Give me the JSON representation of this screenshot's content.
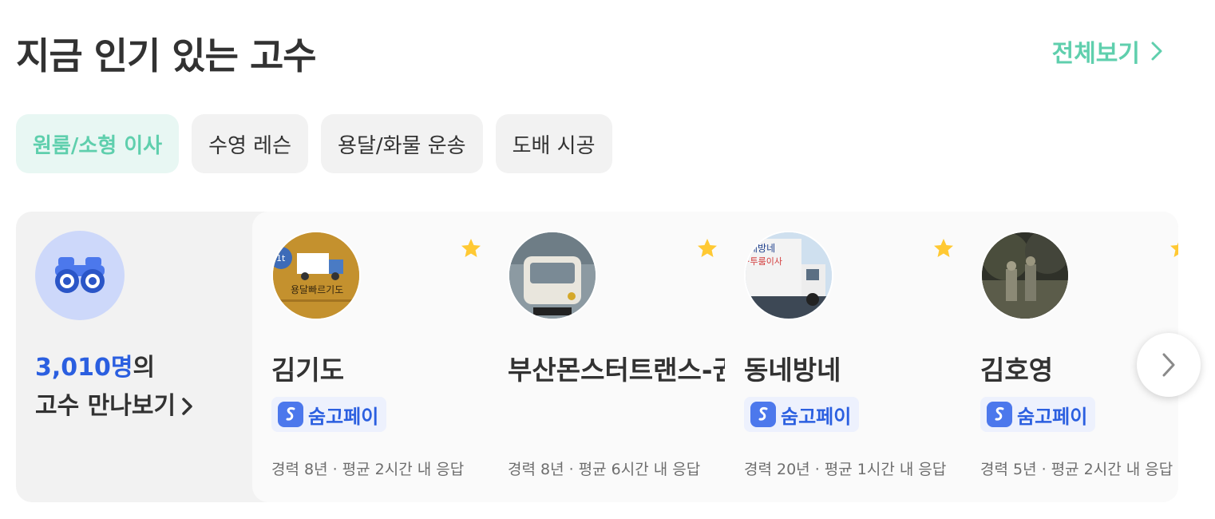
{
  "header": {
    "title": "지금 인기 있는 고수",
    "view_all": "전체보기"
  },
  "chips": [
    {
      "label": "원룸/소형 이사",
      "active": true
    },
    {
      "label": "수영 레슨",
      "active": false
    },
    {
      "label": "용달/화물 운송",
      "active": false
    },
    {
      "label": "도배 시공",
      "active": false
    }
  ],
  "intro": {
    "count": "3,010명",
    "count_suffix": "의",
    "link_label": "고수 만나보기"
  },
  "cards": [
    {
      "name": "김기도",
      "pay_badge": "숨고페이",
      "meta": "경력 8년 · 평균 2시간 내 응답",
      "avatar_text": "용달빠르기도",
      "avatar_badge": "1t"
    },
    {
      "name": "부산몬스터트랜스-권",
      "pay_badge": "",
      "meta": "경력 8년 · 평균 6시간 내 응답"
    },
    {
      "name": "동네방네",
      "pay_badge": "숨고페이",
      "meta": "경력 20년 · 평균 1시간 내 응답",
      "avatar_text": "네방네",
      "avatar_text2": "·투룸이사"
    },
    {
      "name": "김호영",
      "pay_badge": "숨고페이",
      "meta": "경력 5년 · 평균 2시간 내 응답"
    }
  ],
  "colors": {
    "accent": "#5fcfad",
    "brand_blue": "#2b5fe0",
    "star": "#ffc933"
  },
  "icons": [
    "chevron-right-icon",
    "binoculars-icon",
    "star-icon",
    "soomgo-pay-icon"
  ]
}
